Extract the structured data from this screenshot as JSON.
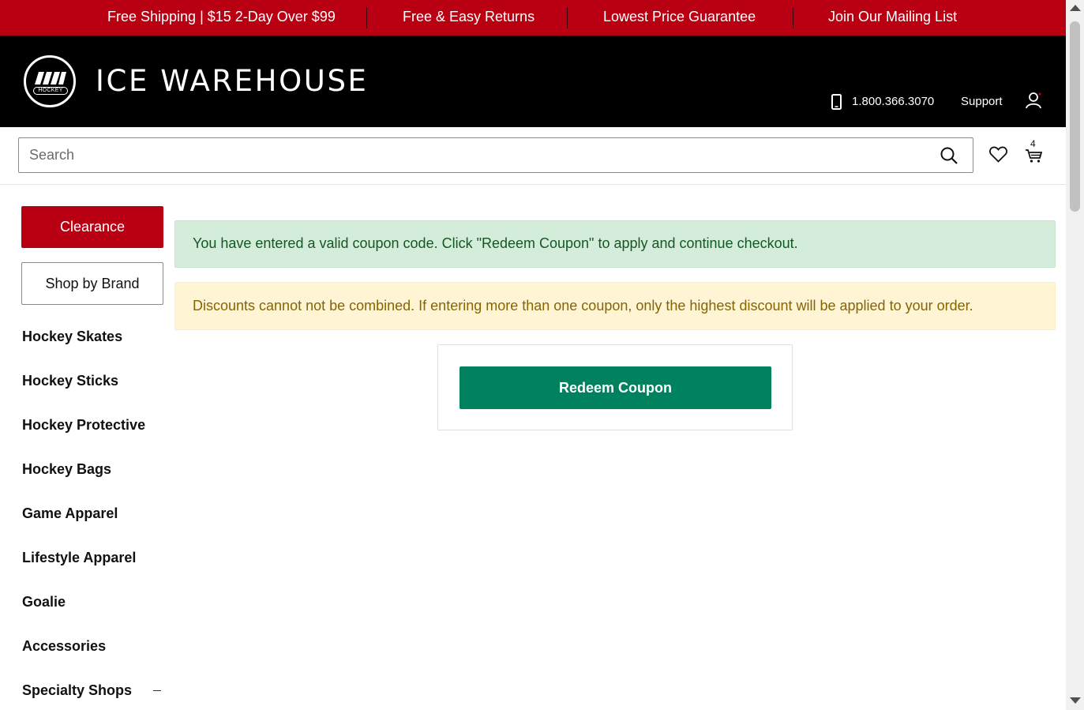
{
  "promo_bar": {
    "items": [
      "Free Shipping | $15 2-Day Over $99",
      "Free & Easy Returns",
      "Lowest Price Guarantee",
      "Join Our Mailing List"
    ]
  },
  "header": {
    "logo_text": "HOCKEY",
    "brand_name": "ICE WAREHOUSE",
    "phone": "1.800.366.3070",
    "support_label": "Support",
    "icons": [
      "phone-icon",
      "user-icon"
    ]
  },
  "search": {
    "placeholder": "Search",
    "value": "",
    "cart_count": "4",
    "icons": [
      "search-icon",
      "heart-icon",
      "cart-icon"
    ]
  },
  "sidebar": {
    "clearance_label": "Clearance",
    "brand_label": "Shop by Brand",
    "items": [
      "Hockey Skates",
      "Hockey Sticks",
      "Hockey Protective",
      "Hockey Bags",
      "Game Apparel",
      "Lifestyle Apparel",
      "Goalie",
      "Accessories",
      "Specialty Shops"
    ]
  },
  "main": {
    "success_message": "You have entered a valid coupon code. Click \"Redeem Coupon\" to apply and continue checkout.",
    "warning_message": "Discounts cannot not be combined. If entering more than one coupon, only the highest discount will be applied to your order.",
    "redeem_label": "Redeem Coupon"
  },
  "colors": {
    "brand_red": "#b90012",
    "header_black": "#000000",
    "redeem_green": "#00825f",
    "success_bg": "#d4eddb",
    "warning_bg": "#fff5d5"
  }
}
